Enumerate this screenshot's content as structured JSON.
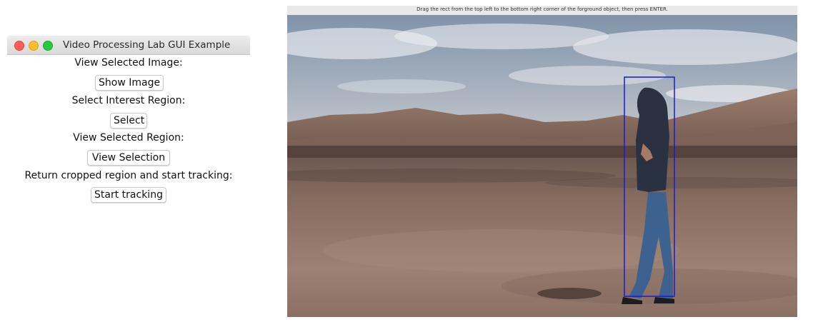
{
  "control_window": {
    "title": "Video Processing Lab GUI Example",
    "rows": [
      {
        "label": "View Selected Image:",
        "button": "Show Image"
      },
      {
        "label": "Select Interest Region:",
        "button": "Select"
      },
      {
        "label": "View Selected Region:",
        "button": "View Selection"
      },
      {
        "label": "Return cropped region and start tracking:",
        "button": "Start tracking"
      }
    ]
  },
  "roi_window": {
    "instruction": "Drag the rect from the top left to the bottom right corner of the forground object, then press ENTER.",
    "selection_color": "#1a1ad9"
  },
  "colors": {
    "sky_top": "#7f93a9",
    "sky_bottom": "#c7ccd3",
    "desert": "#8a6f62",
    "desert_dark": "#4f3e37"
  }
}
